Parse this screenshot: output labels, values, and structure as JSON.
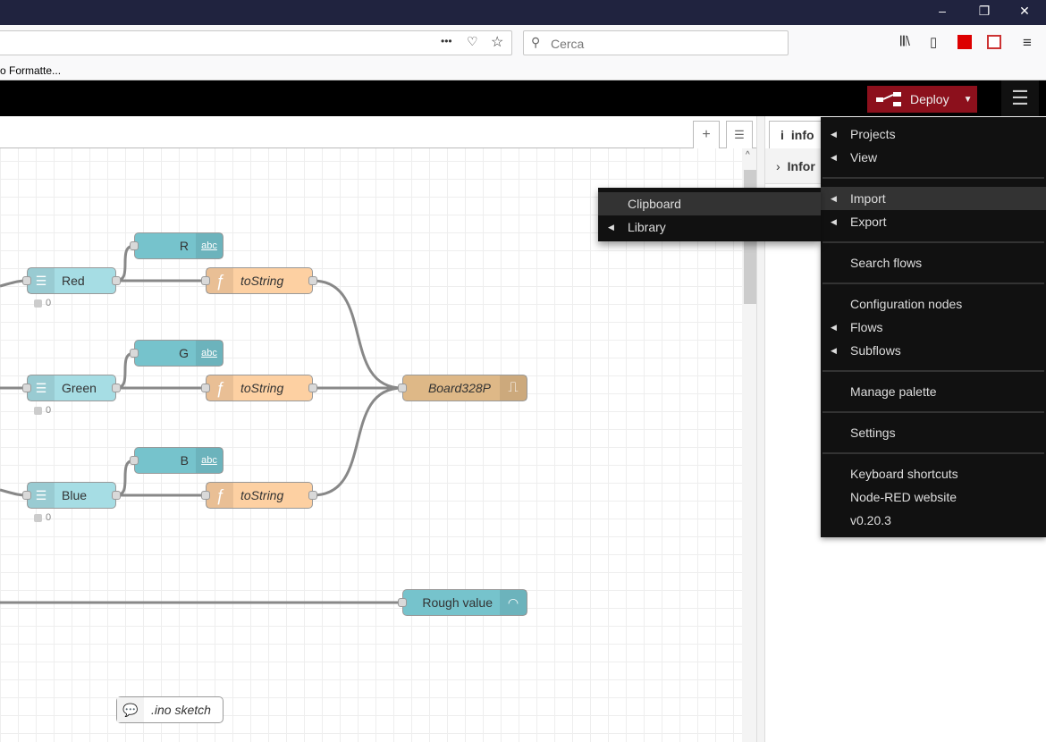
{
  "browser": {
    "search_placeholder": "Cerca",
    "bookmark": "o Formatte...",
    "minimize": "–",
    "restore": "❐",
    "close": "✕",
    "more": "•••"
  },
  "header": {
    "deploy_label": "Deploy"
  },
  "workspace": {
    "add_label": "+",
    "list_label": "☰"
  },
  "sidebar": {
    "tab_label": "info",
    "section_label": "Infor"
  },
  "nodes": {
    "red": "Red",
    "green": "Green",
    "blue": "Blue",
    "r": "R",
    "g": "G",
    "b": "B",
    "tostring": "toString",
    "board": "Board328P",
    "rough": "Rough value",
    "comment": ".ino sketch",
    "status_value": "0"
  },
  "menu": {
    "items": [
      "Projects",
      "View",
      "Import",
      "Export",
      "Search flows",
      "Configuration nodes",
      "Flows",
      "Subflows",
      "Manage palette",
      "Settings",
      "Keyboard shortcuts",
      "Node-RED website",
      "v0.20.3"
    ],
    "highlighted": "Import"
  },
  "submenu": {
    "items": [
      "Clipboard",
      "Library"
    ],
    "highlighted": "Clipboard"
  },
  "colors": {
    "deploy": "#8c101c",
    "switch_node": "#a6dde4",
    "debug_node": "#76c3cc",
    "function_node": "#fdd0a2",
    "serial_node": "#deb887",
    "menu_bg": "#111111"
  }
}
